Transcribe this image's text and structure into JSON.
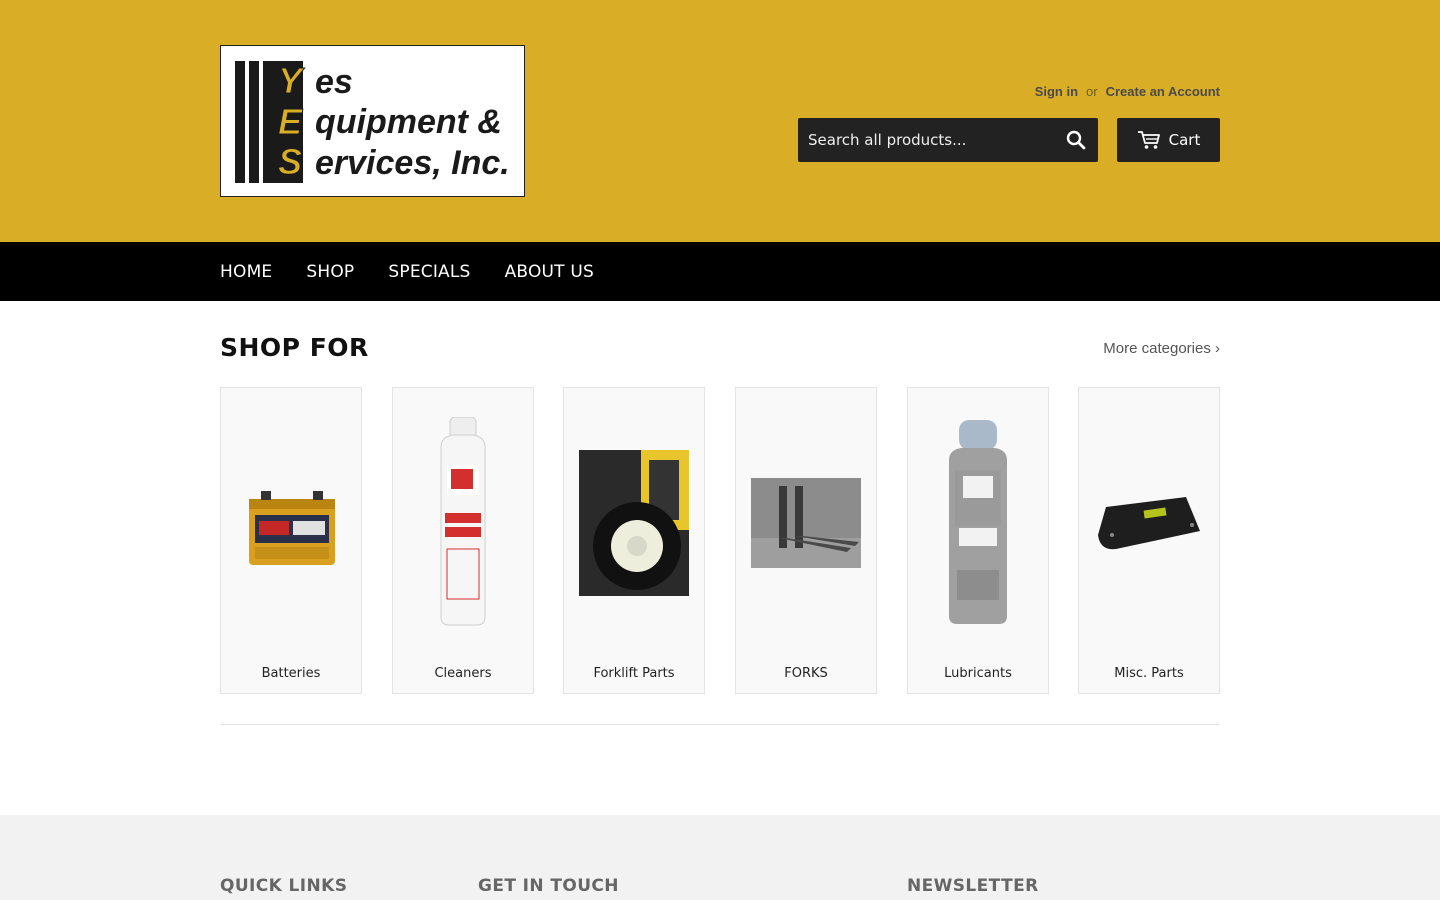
{
  "brand": {
    "logo_letters": [
      "Y",
      "E",
      "S"
    ],
    "logo_words": [
      "es",
      "quipment &",
      "ervices, Inc."
    ],
    "colors": {
      "header": "#d9ae26",
      "nav": "#000000",
      "button": "#222222"
    }
  },
  "account": {
    "sign_in": "Sign in",
    "or": "or",
    "create": "Create an Account"
  },
  "search": {
    "placeholder": "Search all products...",
    "icon": "search-icon"
  },
  "cart": {
    "label": "Cart",
    "icon": "cart-icon"
  },
  "nav": {
    "items": [
      "HOME",
      "SHOP",
      "SPECIALS",
      "ABOUT US"
    ]
  },
  "main": {
    "title": "SHOP FOR",
    "more_link": "More categories ›",
    "categories": [
      "Batteries",
      "Cleaners",
      "Forklift Parts",
      "FORKS",
      "Lubricants",
      "Misc. Parts"
    ]
  },
  "footer": {
    "headings": [
      "QUICK LINKS",
      "GET IN TOUCH",
      "NEWSLETTER"
    ]
  }
}
